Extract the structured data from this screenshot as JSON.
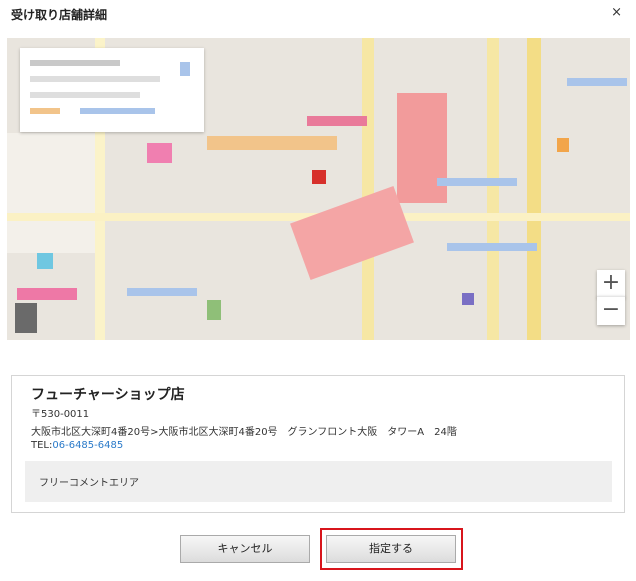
{
  "dialog": {
    "title": "受け取り店舗詳細",
    "close_label": "×"
  },
  "map": {
    "zoom_in_label": "+",
    "zoom_out_label": "−"
  },
  "store": {
    "name": "フューチャーショップ店",
    "postal": "〒530-0011",
    "address": "大阪市北区大深町4番20号>大阪市北区大深町4番20号　グランフロント大阪　タワーA　24階",
    "tel_label": "TEL:",
    "tel_number": "06-6485-6485",
    "comment": "フリーコメントエリア"
  },
  "buttons": {
    "cancel_label": "キャンセル",
    "select_label": "指定する"
  },
  "colors": {
    "link": "#2a7ac9",
    "highlight_border": "#d8151c"
  }
}
